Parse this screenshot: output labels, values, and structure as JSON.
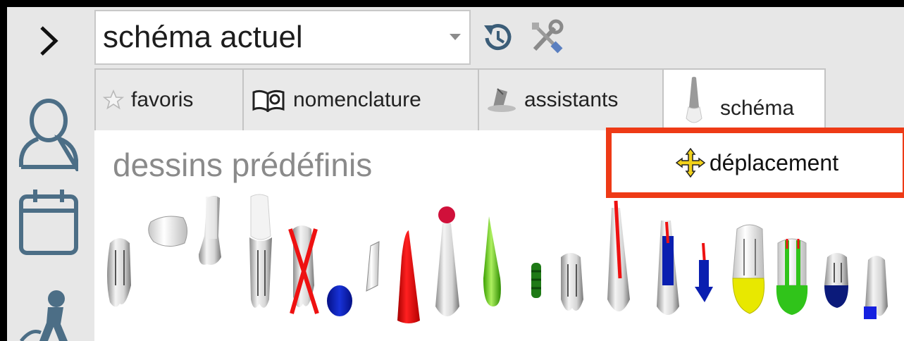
{
  "rail": {
    "items": [
      {
        "name": "expand",
        "icon": "chevron-right-icon"
      },
      {
        "name": "patient",
        "icon": "user-icon"
      },
      {
        "name": "agenda",
        "icon": "calendar-icon"
      },
      {
        "name": "activity",
        "icon": "worker-icon"
      }
    ]
  },
  "toolbar": {
    "schema_select": {
      "value": "schéma actuel"
    },
    "history_icon": "history-icon",
    "tools_icon": "tools-icon"
  },
  "tabs": [
    {
      "label": "favoris",
      "icon": "star-icon",
      "active": false
    },
    {
      "label": "nomenclature",
      "icon": "book-icon",
      "active": false
    },
    {
      "label": "assistants",
      "icon": "wizard-hat-icon",
      "active": false
    },
    {
      "label": "schéma",
      "icon": "tooth-icon",
      "active": true
    }
  ],
  "content": {
    "section_title": "dessins prédéfinis",
    "move_label": "déplacement",
    "move_icon": "move-arrows-icon"
  },
  "colors": {
    "highlight": "#ee3a16",
    "red": "#ee1111",
    "blue": "#0a1fb0",
    "green": "#30c41a",
    "yellow": "#e8e800",
    "navy": "#0b1a7a"
  }
}
